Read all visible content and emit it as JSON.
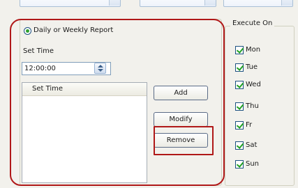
{
  "radio": {
    "label": "Daily or Weekly Report",
    "selected": true
  },
  "set_time": {
    "label": "Set Time",
    "value": "12:00:00"
  },
  "list": {
    "column_header": "Set Time",
    "rows": []
  },
  "buttons": {
    "add": "Add",
    "modify": "Modify",
    "remove": "Remove"
  },
  "execute_on": {
    "title": "Execute On",
    "days": [
      {
        "label": "Mon",
        "checked": true
      },
      {
        "label": "Tue",
        "checked": true
      },
      {
        "label": "Wed",
        "checked": true
      },
      {
        "label": "Thu",
        "checked": true
      },
      {
        "label": "Fr",
        "checked": true
      },
      {
        "label": "Sat",
        "checked": true
      },
      {
        "label": "Sun",
        "checked": true
      }
    ]
  },
  "colors": {
    "annotation": "#b01818",
    "check_green": "#21a121",
    "panel_bg": "#f2f1ec",
    "border_blue": "#7f9db9"
  }
}
